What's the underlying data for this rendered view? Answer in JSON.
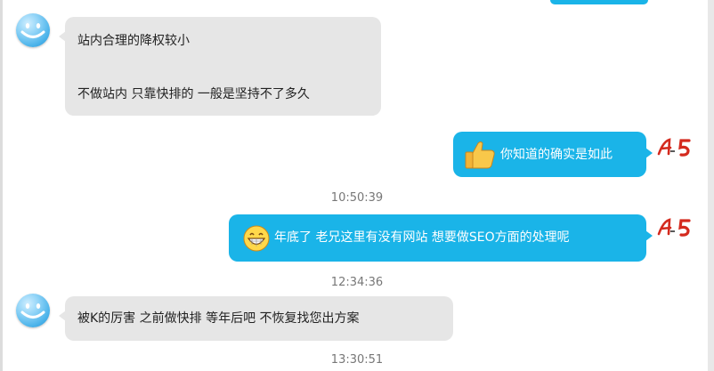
{
  "messages": [
    {
      "side": "in",
      "lines": [
        "站内合理的降权较小",
        "不做站内  只靠快排的  一般是坚持不了多久"
      ]
    },
    {
      "side": "out",
      "emoji": "thumbs-up-emoji",
      "text": "你知道的确实是如此"
    },
    {
      "side": "out",
      "emoji": "grin-emoji",
      "text": "年底了  老兄这里有没有网站 想要做SEO方面的处理呢"
    },
    {
      "side": "in",
      "lines": [
        "被K的厉害  之前做快排   等年后吧   不恢复找您出方案"
      ]
    }
  ],
  "timestamps": [
    "10:50:39",
    "12:34:36",
    "13:30:51"
  ],
  "brand": {
    "name": "A5",
    "primary": "#d42a1e",
    "secondary": "#222222"
  },
  "colors": {
    "incoming_bubble": "#e6e6e6",
    "outgoing_bubble": "#1ab4e8",
    "timestamp_text": "#777777"
  }
}
